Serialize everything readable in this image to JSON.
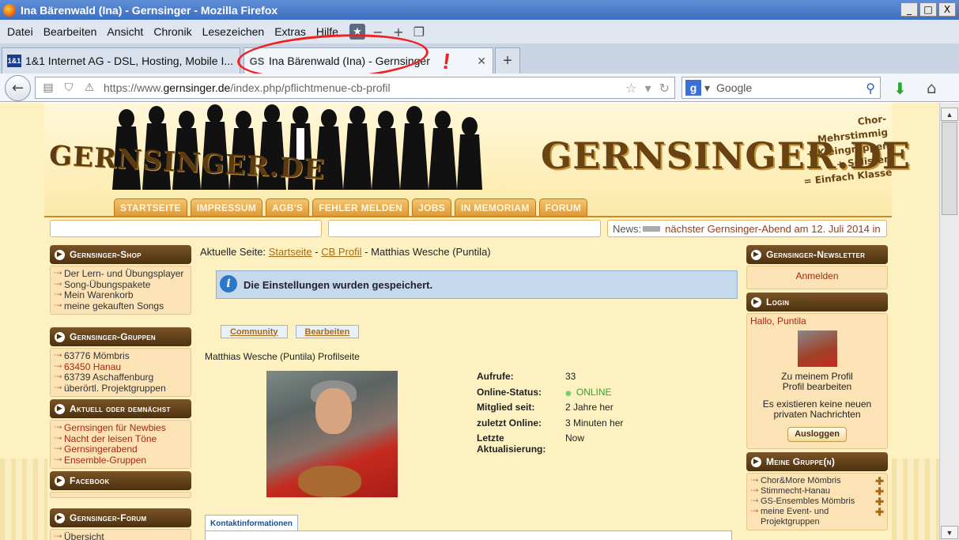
{
  "window": {
    "title": "Ina Bärenwald (Ina) - Gernsinger - Mozilla Firefox",
    "controls": [
      "_",
      "□",
      "X"
    ]
  },
  "menubar": [
    "Datei",
    "Bearbeiten",
    "Ansicht",
    "Chronik",
    "Lesezeichen",
    "Extras",
    "Hilfe"
  ],
  "tabs": [
    {
      "favicon": "1&1",
      "label": "1&1 Internet AG - DSL, Hosting, Mobile I..."
    },
    {
      "favicon": "GS",
      "label": "Ina Bärenwald (Ina) - Gernsinger"
    }
  ],
  "annotation_mark": "!",
  "navbar": {
    "url_prefix": "https://www.",
    "url_domain": "gernsinger.de",
    "url_path": "/index.php/pflichtmenue-cb-profil",
    "search_engine": "g",
    "search_placeholder": "Google"
  },
  "site": {
    "logo_small": "GERNSINGER.DE",
    "logo_big": "GERNSINGER.DE",
    "tagline": [
      "Chor-Mehrstimmig",
      "+ Kleingruppen",
      "+ Solisten",
      "= Einfach Klasse"
    ],
    "nav": [
      "STARTSEITE",
      "IMPRESSUM",
      "AGB'S",
      "FEHLER MELDEN",
      "JOBS",
      "IN MEMORIAM",
      "FORUM"
    ],
    "news_label": "News:",
    "news_text": "nächster Gernsinger-Abend am 12. Juli 2014 in"
  },
  "left": {
    "shop": {
      "title": "Gernsinger-Shop",
      "items": [
        "Der Lern- und Übungsplayer",
        "Song-Übungspakete",
        "Mein Warenkorb",
        "meine gekauften Songs"
      ]
    },
    "gruppen": {
      "title": "Gernsinger-Gruppen",
      "items": [
        "63776 Mömbris",
        "63450 Hanau",
        "63739 Aschaffenburg",
        "überörtl. Projektgruppen"
      ]
    },
    "aktuell": {
      "title": "Aktuell oder demnächst",
      "items": [
        "Gernsingen für Newbies",
        "Nacht der leisen Töne",
        "Gernsingerabend",
        "Ensemble-Gruppen"
      ]
    },
    "facebook": {
      "title": "Facebook"
    },
    "forum": {
      "title": "Gernsinger-Forum",
      "items": [
        "Übersicht"
      ]
    }
  },
  "main": {
    "breadcrumb_label": "Aktuelle Seite:",
    "breadcrumb_home": "Startseite",
    "breadcrumb_sep1": "-",
    "breadcrumb_cb": "CB Profil",
    "breadcrumb_sep2": "-",
    "breadcrumb_current": "Matthias Wesche (Puntila)",
    "message": "Die Einstellungen wurden gespeichert.",
    "subtabs": [
      "Community",
      "Bearbeiten"
    ],
    "profile_title": "Matthias Wesche (Puntila) Profilseite",
    "stats": [
      {
        "k": "Aufrufe:",
        "v": "33"
      },
      {
        "k": "Online-Status:",
        "v": "ONLINE"
      },
      {
        "k": "Mitglied seit:",
        "v": "2 Jahre her"
      },
      {
        "k": "zuletzt Online:",
        "v": "3 Minuten her"
      },
      {
        "k": "Letzte Aktualisierung:",
        "v": "Now"
      }
    ],
    "kontakt_tab": "Kontaktinformationen"
  },
  "right": {
    "newsletter": {
      "title": "Gernsinger-Newsletter",
      "link": "Anmelden"
    },
    "login": {
      "title": "Login",
      "greeting": "Hallo, Puntila",
      "profile_link": "Zu meinem Profil",
      "edit_link": "Profil bearbeiten",
      "messages": "Es existieren keine neuen privaten Nachrichten",
      "logout": "Ausloggen"
    },
    "gruppe": {
      "title": "Meine Gruppe(n)",
      "items": [
        "Chor&More Mömbris",
        "Stimmecht-Hanau",
        "GS-Ensembles Mömbris",
        "meine Event- und Projektgruppen"
      ]
    }
  },
  "colors": {
    "accent": "#a82712",
    "header_brown": "#5c3b12",
    "nav_orange": "#e09a34",
    "online_green": "#3aa02e"
  }
}
